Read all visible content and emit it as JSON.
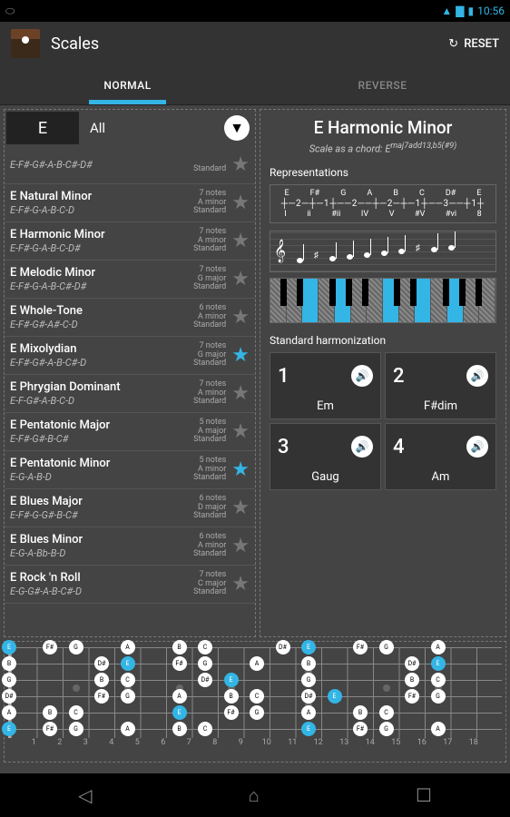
{
  "status": {
    "time": "10:56"
  },
  "appbar": {
    "title": "Scales",
    "reset": "RESET"
  },
  "tabs": {
    "normal": "NORMAL",
    "reverse": "REVERSE"
  },
  "selector": {
    "key": "E",
    "filter": "All"
  },
  "scales": [
    {
      "name": "",
      "notes": "E-F#-G#-A-B-C#-D#",
      "meta1": "",
      "meta2": "Standard",
      "fav": false
    },
    {
      "name": "E Natural Minor",
      "notes": "E-F#-G-A-B-C-D",
      "meta1": "7 notes",
      "meta2": "A minor",
      "meta3": "Standard",
      "fav": false
    },
    {
      "name": "E Harmonic Minor",
      "notes": "E-F#-G-A-B-C-D#",
      "meta1": "7 notes",
      "meta2": "A minor",
      "meta3": "Standard",
      "fav": false
    },
    {
      "name": "E Melodic Minor",
      "notes": "E-F#-G-A-B-C#-D#",
      "meta1": "7 notes",
      "meta2": "G major",
      "meta3": "Standard",
      "fav": false
    },
    {
      "name": "E Whole-Tone",
      "notes": "E-F#-G#-A#-C-D",
      "meta1": "6 notes",
      "meta2": "A minor",
      "meta3": "Standard",
      "fav": false
    },
    {
      "name": "E Mixolydian",
      "notes": "E-F#-G#-A-B-C#-D",
      "meta1": "7 notes",
      "meta2": "G major",
      "meta3": "Standard",
      "fav": true
    },
    {
      "name": "E Phrygian Dominant",
      "notes": "E-F-G#-A-B-C-D",
      "meta1": "7 notes",
      "meta2": "A minor",
      "meta3": "Standard",
      "fav": false
    },
    {
      "name": "E Pentatonic Major",
      "notes": "E-F#-G#-B-C#",
      "meta1": "5 notes",
      "meta2": "A major",
      "meta3": "Standard",
      "fav": false
    },
    {
      "name": "E Pentatonic Minor",
      "notes": "E-G-A-B-D",
      "meta1": "5 notes",
      "meta2": "A minor",
      "meta3": "Standard",
      "fav": true
    },
    {
      "name": "E Blues Major",
      "notes": "E-F#-G-G#-B-C#",
      "meta1": "6 notes",
      "meta2": "D major",
      "meta3": "Standard",
      "fav": false
    },
    {
      "name": "E Blues Minor",
      "notes": "E-G-A-Bb-B-D",
      "meta1": "6 notes",
      "meta2": "A minor",
      "meta3": "Standard",
      "fav": false
    },
    {
      "name": "E Rock 'n Roll",
      "notes": "E-G-G#-A-B-C#-D",
      "meta1": "7 notes",
      "meta2": "C major",
      "meta3": "Standard",
      "fav": false
    }
  ],
  "detail": {
    "title": "E Harmonic Minor",
    "chord_label": "Scale as a chord: E",
    "chord_sup": "maj7add13,b5(#9)",
    "sections": {
      "rep": "Representations",
      "harm": "Standard harmonization"
    },
    "interval_notes": [
      "E",
      "F#",
      "G",
      "A",
      "B",
      "C",
      "D#",
      "E"
    ],
    "interval_steps": "┼─2─┼─1┼──2──┼─2─┼─1┼──3──┼1┼",
    "interval_deg": [
      "I",
      "ii",
      "#ii",
      "IV",
      "V",
      "#V",
      "#vi",
      "8"
    ],
    "harmonization": [
      {
        "num": "1",
        "chord": "Em"
      },
      {
        "num": "2",
        "chord": "F#dim"
      },
      {
        "num": "3",
        "chord": "Gaug"
      },
      {
        "num": "4",
        "chord": "Am"
      }
    ]
  },
  "fretboard": {
    "frets": [
      "1",
      "2",
      "3",
      "4",
      "5",
      "6",
      "7",
      "8",
      "9",
      "10",
      "11",
      "12",
      "13",
      "14",
      "15",
      "16",
      "17",
      "18"
    ]
  }
}
